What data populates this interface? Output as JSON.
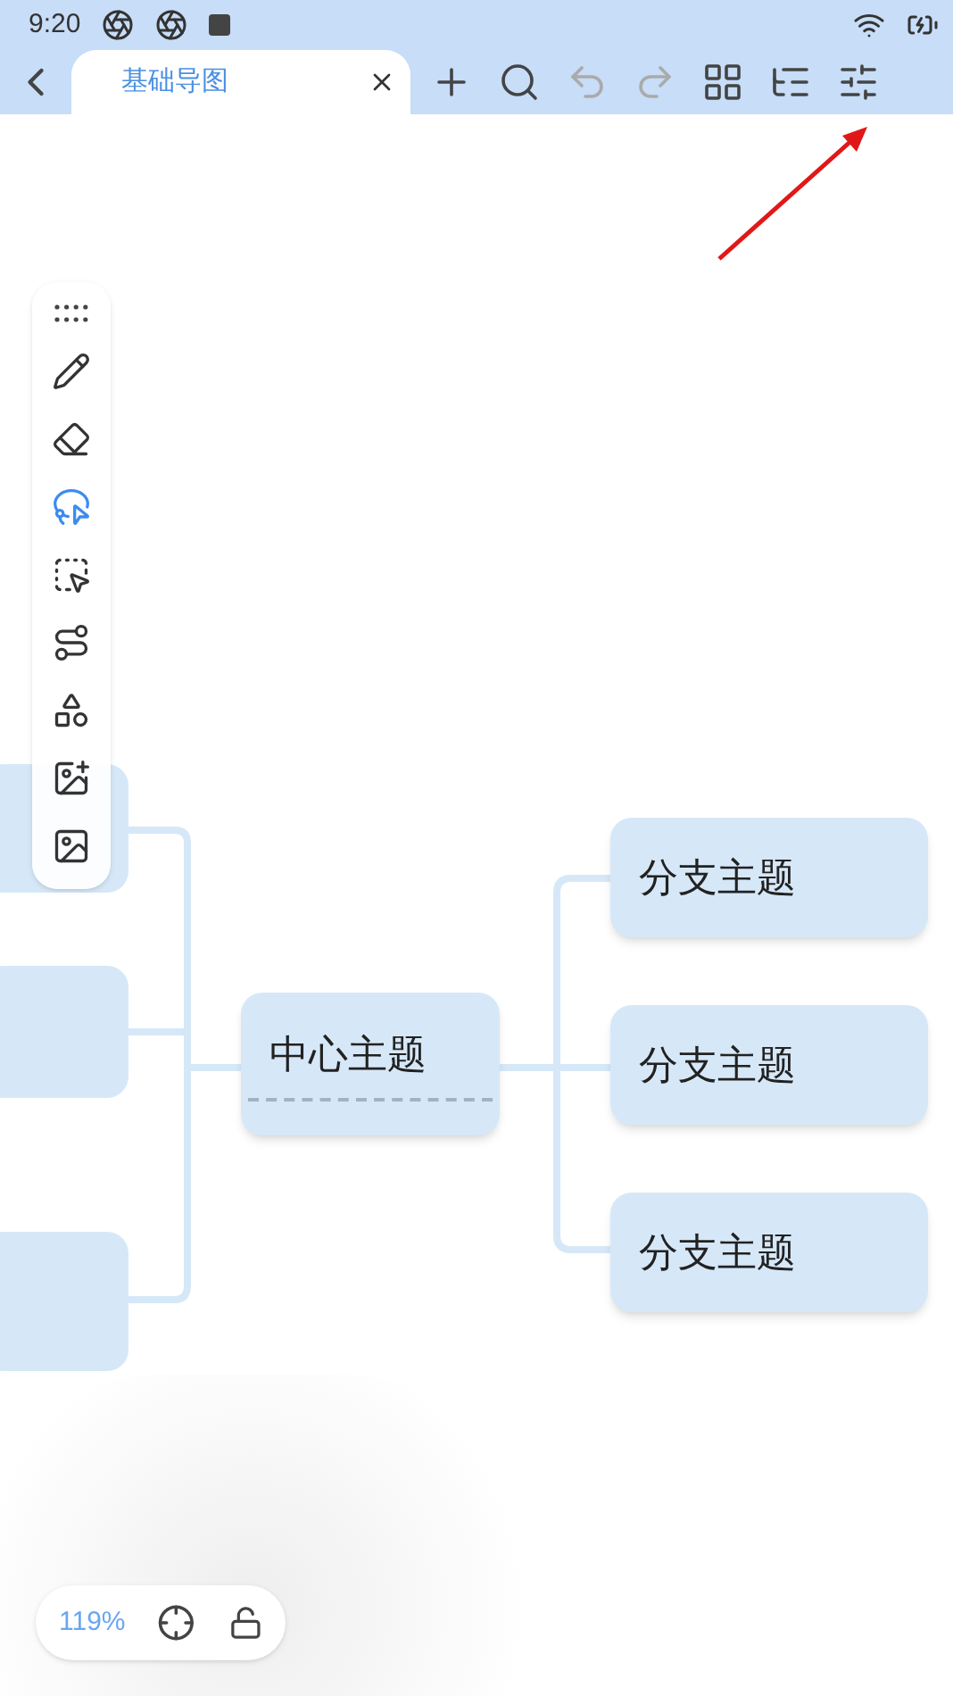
{
  "status_bar": {
    "time": "9:20"
  },
  "tab": {
    "title": "基础导图",
    "selected": true
  },
  "actions": [
    {
      "kind": "add",
      "disabled": false
    },
    {
      "kind": "search",
      "disabled": false
    },
    {
      "kind": "undo",
      "disabled": true
    },
    {
      "kind": "redo",
      "disabled": true
    },
    {
      "kind": "layout",
      "disabled": false
    },
    {
      "kind": "outline",
      "disabled": false
    },
    {
      "kind": "settings",
      "disabled": false
    }
  ],
  "tools": [
    {
      "kind": "pencil",
      "selected": false
    },
    {
      "kind": "eraser",
      "selected": false
    },
    {
      "kind": "lasso",
      "selected": true
    },
    {
      "kind": "select",
      "selected": false
    },
    {
      "kind": "connector",
      "selected": false
    },
    {
      "kind": "shapes",
      "selected": false
    },
    {
      "kind": "image-add",
      "selected": false
    },
    {
      "kind": "image",
      "selected": false
    }
  ],
  "mindmap": {
    "central": "中心主题",
    "branches": [
      "分支主题",
      "分支主题",
      "分支主题"
    ]
  },
  "zoom": {
    "level_text": "119%"
  }
}
